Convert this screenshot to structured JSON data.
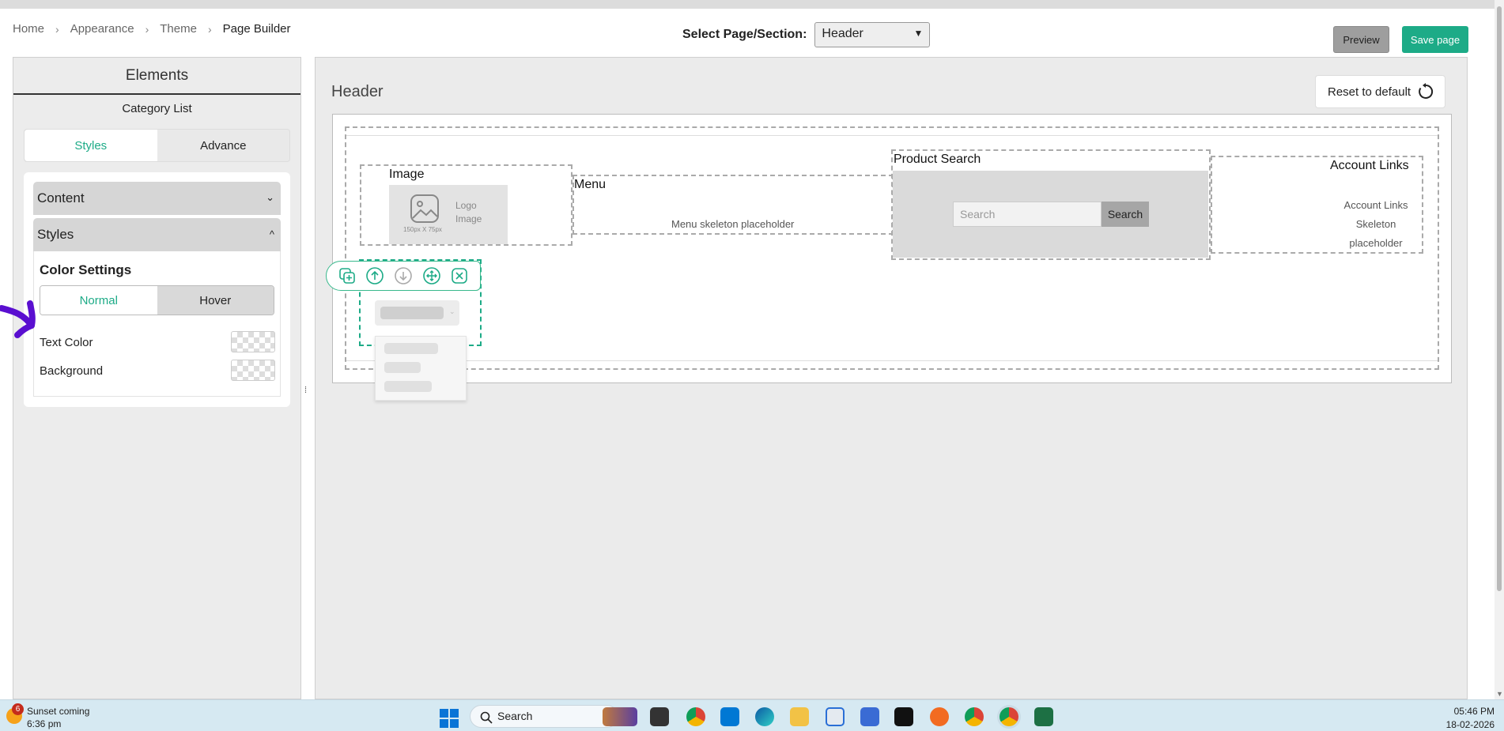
{
  "breadcrumb": {
    "home": "Home",
    "appearance": "Appearance",
    "theme": "Theme",
    "current": "Page Builder"
  },
  "page_select": {
    "label": "Select Page/Section:",
    "value": "Header"
  },
  "actions": {
    "preview": "Preview",
    "save": "Save page"
  },
  "left_panel": {
    "title": "Elements",
    "subtitle": "Category List",
    "tabs": [
      "Styles",
      "Advance"
    ],
    "content_label": "Content",
    "styles_label": "Styles",
    "color_settings": "Color Settings",
    "state_tabs": [
      "Normal",
      "Hover"
    ],
    "text_color": "Text Color",
    "background": "Background"
  },
  "canvas": {
    "title": "Header",
    "reset": "Reset to default",
    "image_block": {
      "label": "Image",
      "logo_text_1": "Logo",
      "logo_text_2": "Image",
      "dims": "150px X 75px"
    },
    "menu_block": {
      "label": "Menu",
      "placeholder": "Menu skeleton placeholder"
    },
    "search_block": {
      "label": "Product Search",
      "input_placeholder": "Search",
      "button": "Search"
    },
    "account_block": {
      "label": "Account Links",
      "line1": "Account Links",
      "line2": "Skeleton",
      "line3": "placeholder"
    }
  },
  "taskbar": {
    "weather_title": "Sunset coming",
    "weather_time": "6:36 pm",
    "notif_count": "6",
    "search": "Search",
    "time": "05:46 PM",
    "date": "18-02-2026"
  },
  "colors": {
    "accent": "#1dab87",
    "selection": "#1dab87",
    "annotation": "#5a0fd0"
  }
}
